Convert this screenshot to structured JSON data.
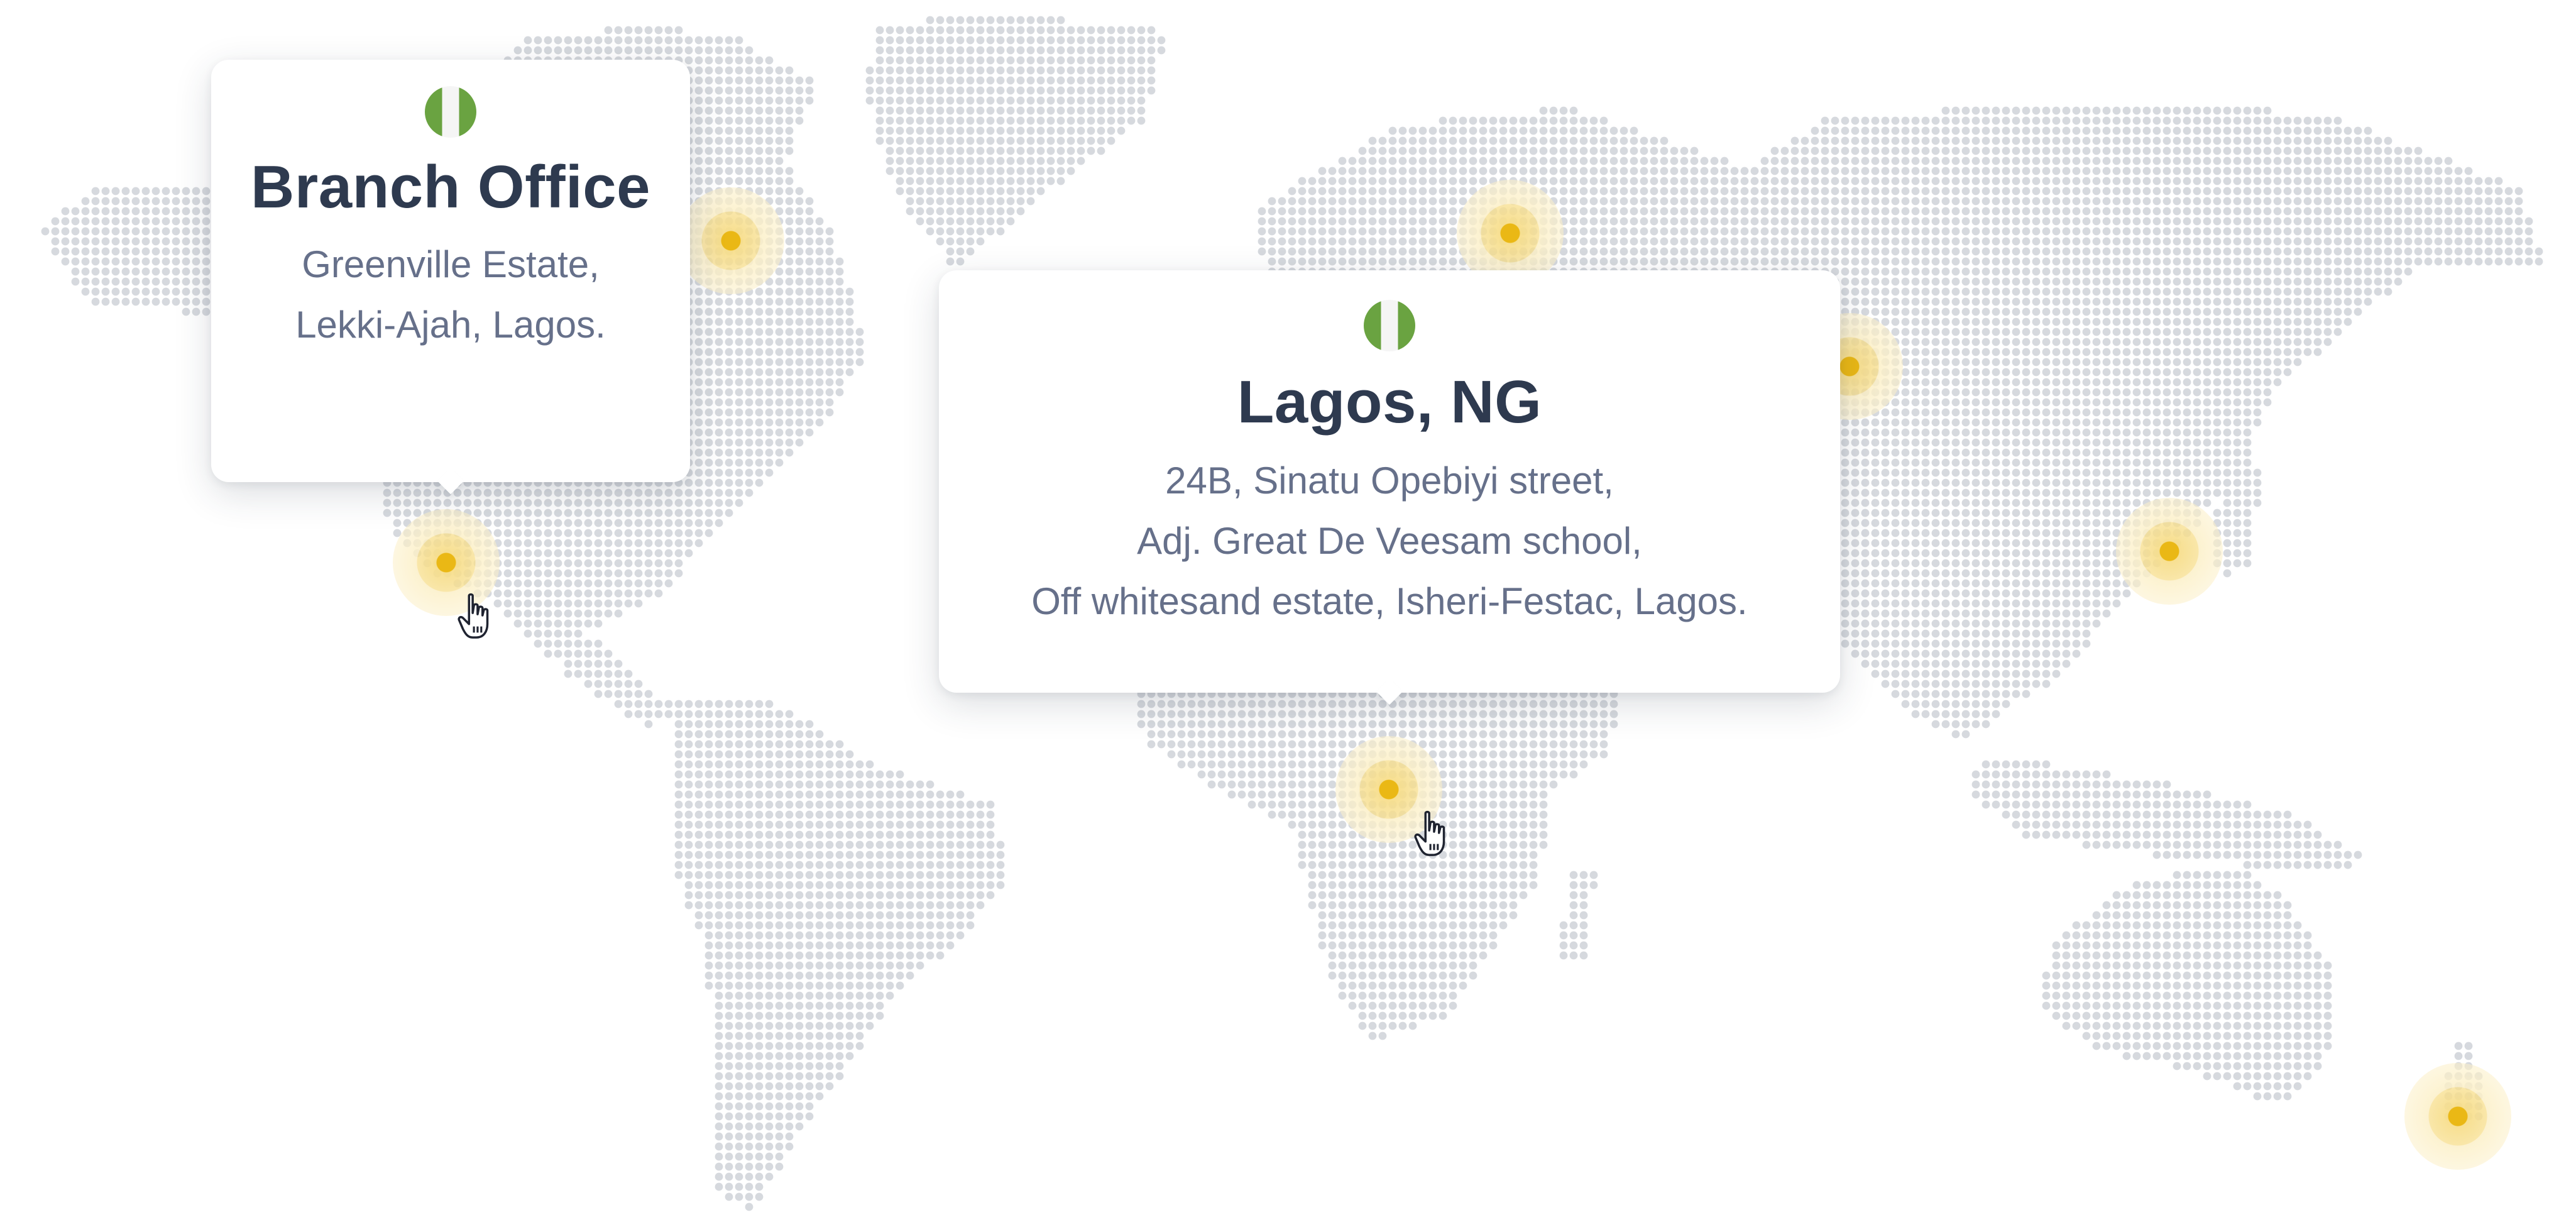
{
  "map": {
    "dot_color": "#d6d9de",
    "marker_color": "#eab815",
    "marker_halo_color": "#f7de8c"
  },
  "markers": [
    {
      "name": "north-america-east"
    },
    {
      "name": "mexico"
    },
    {
      "name": "scandinavia"
    },
    {
      "name": "russia"
    },
    {
      "name": "east-asia"
    },
    {
      "name": "central-africa"
    },
    {
      "name": "new-zealand"
    }
  ],
  "tooltips": {
    "branch": {
      "flag_icon": "nigeria-flag-icon",
      "title": "Branch Office",
      "address": [
        "Greenville Estate,",
        "Lekki-Ajah, Lagos."
      ]
    },
    "lagos": {
      "flag_icon": "nigeria-flag-icon",
      "title": "Lagos, NG",
      "address": [
        "24B, Sinatu Opebiyi street,",
        "Adj. Great De Veesam school,",
        "Off whitesand estate, Isheri-Festac, Lagos."
      ]
    }
  },
  "colors": {
    "title": "#2e3a4f",
    "text": "#66708a",
    "flag_green": "#6aa341"
  }
}
